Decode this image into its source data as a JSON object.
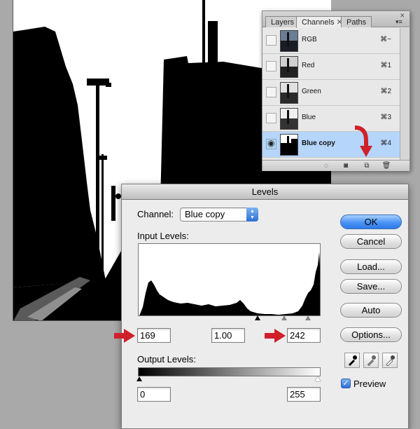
{
  "channels_panel": {
    "tabs": [
      {
        "label": "Layers"
      },
      {
        "label": "Channels"
      },
      {
        "label": "Paths"
      }
    ],
    "rows": [
      {
        "name": "RGB",
        "shortcut": "⌘~"
      },
      {
        "name": "Red",
        "shortcut": "⌘1"
      },
      {
        "name": "Green",
        "shortcut": "⌘2"
      },
      {
        "name": "Blue",
        "shortcut": "⌘3"
      },
      {
        "name": "Blue copy",
        "shortcut": "⌘4",
        "selected": true,
        "visible": true
      }
    ],
    "tab_close": "✕",
    "eye_glyph": "◉"
  },
  "levels": {
    "title": "Levels",
    "channel_label": "Channel:",
    "channel_value": "Blue copy",
    "input_levels_label": "Input Levels:",
    "input_black": "169",
    "input_gamma": "1.00",
    "input_white": "242",
    "output_levels_label": "Output Levels:",
    "output_black": "0",
    "output_white": "255",
    "buttons": {
      "ok": "OK",
      "cancel": "Cancel",
      "load": "Load...",
      "save": "Save...",
      "auto": "Auto",
      "options": "Options..."
    },
    "preview_label": "Preview",
    "preview_checked": true,
    "check_glyph": "✓"
  },
  "colors": {
    "highlight": "#b5d5fb",
    "default_button": "#4a94f4",
    "annotation_arrow": "#d0202a"
  }
}
